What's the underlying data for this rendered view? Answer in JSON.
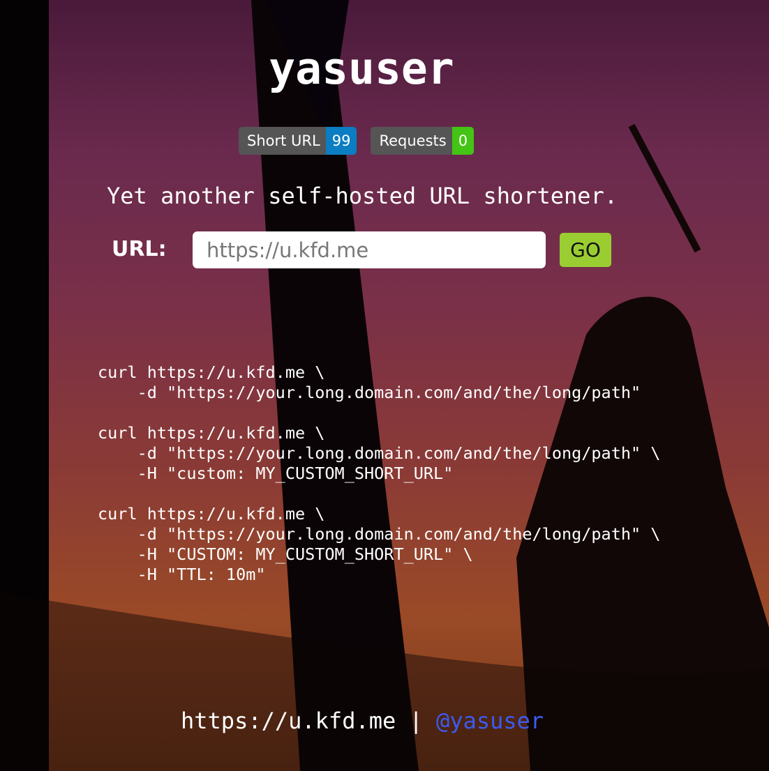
{
  "title": "yasuser",
  "badges": [
    {
      "label": "Short URL",
      "value": "99",
      "color": "#0b7dc2"
    },
    {
      "label": "Requests",
      "value": "0",
      "color": "#44c414"
    }
  ],
  "tagline": "Yet another self-hosted URL shortener.",
  "form": {
    "label": "URL:",
    "placeholder": "https://u.kfd.me",
    "button": "GO"
  },
  "examples": "curl https://u.kfd.me \\\n    -d \"https://your.long.domain.com/and/the/long/path\"\n\ncurl https://u.kfd.me \\\n    -d \"https://your.long.domain.com/and/the/long/path\" \\\n    -H \"custom: MY_CUSTOM_SHORT_URL\"\n\ncurl https://u.kfd.me \\\n    -d \"https://your.long.domain.com/and/the/long/path\" \\\n    -H \"CUSTOM: MY_CUSTOM_SHORT_URL\" \\\n    -H \"TTL: 10m\"",
  "footer": {
    "site": "https://u.kfd.me",
    "separator": " | ",
    "handle": "@yasuser"
  }
}
